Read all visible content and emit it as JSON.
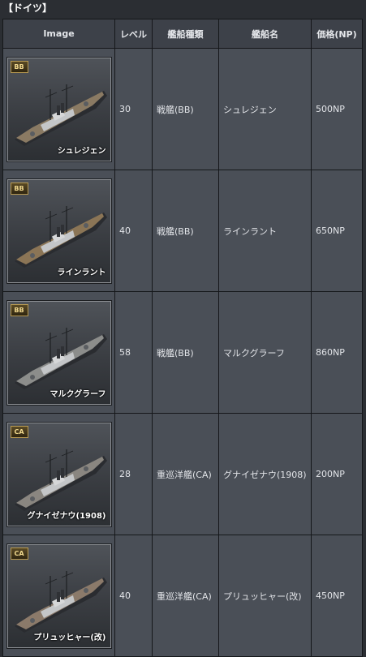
{
  "section_title": "【ドイツ】",
  "headers": {
    "image": "Image",
    "level": "レベル",
    "type": "艦船種類",
    "name": "艦船名",
    "price": "価格(NP)"
  },
  "rows": [
    {
      "badge": "BB",
      "caption": "シュレジェン",
      "level": "30",
      "type": "戦艦(BB)",
      "name": "シュレジェン",
      "price": "500NP",
      "deck_color": "#8a7a63"
    },
    {
      "badge": "BB",
      "caption": "ラインラント",
      "level": "40",
      "type": "戦艦(BB)",
      "name": "ラインラント",
      "price": "650NP",
      "deck_color": "#8b7556"
    },
    {
      "badge": "BB",
      "caption": "マルクグラーフ",
      "level": "58",
      "type": "戦艦(BB)",
      "name": "マルクグラーフ",
      "price": "860NP",
      "deck_color": "#8c8d8b"
    },
    {
      "badge": "CA",
      "caption": "グナイゼナウ(1908)",
      "level": "28",
      "type": "重巡洋艦(CA)",
      "name": "グナイゼナウ(1908)",
      "price": "200NP",
      "deck_color": "#8a8680"
    },
    {
      "badge": "CA",
      "caption": "プリュッヒャー(改)",
      "level": "40",
      "type": "重巡洋艦(CA)",
      "name": "プリュッヒャー(改)",
      "price": "450NP",
      "deck_color": "#8b7a6a"
    }
  ]
}
